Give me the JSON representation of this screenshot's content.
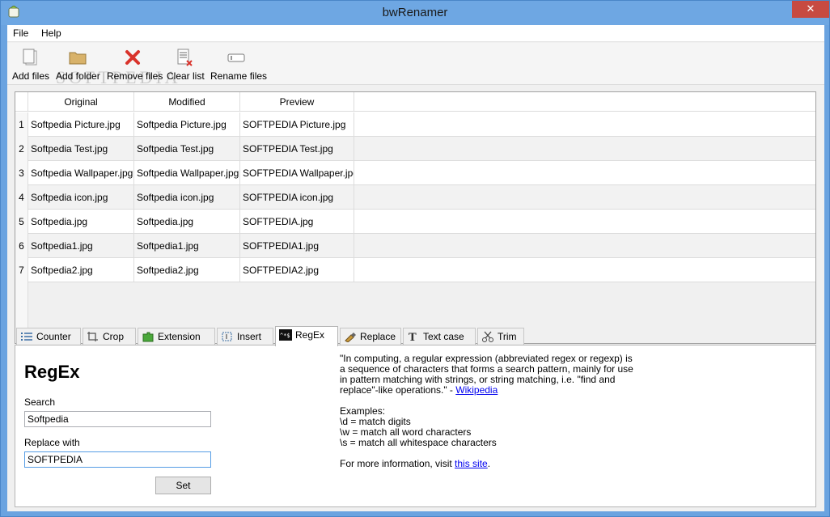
{
  "window": {
    "title": "bwRenamer",
    "close_glyph": "✕"
  },
  "menu": {
    "items": [
      "File",
      "Help"
    ]
  },
  "toolbar": {
    "buttons": [
      {
        "label": "Add files",
        "icon": "add-files-icon"
      },
      {
        "label": "Add folder",
        "icon": "add-folder-icon"
      },
      {
        "label": "Remove files",
        "icon": "remove-files-icon"
      },
      {
        "label": "Clear list",
        "icon": "clear-list-icon"
      },
      {
        "label": "Rename files",
        "icon": "rename-files-icon"
      }
    ],
    "watermark": "SOFTPEDIA"
  },
  "grid": {
    "columns": [
      "Original",
      "Modified",
      "Preview"
    ],
    "rows": [
      {
        "num": "1",
        "original": "Softpedia Picture.jpg",
        "modified": "Softpedia Picture.jpg",
        "preview": "SOFTPEDIA Picture.jpg"
      },
      {
        "num": "2",
        "original": "Softpedia Test.jpg",
        "modified": "Softpedia Test.jpg",
        "preview": "SOFTPEDIA Test.jpg"
      },
      {
        "num": "3",
        "original": "Softpedia Wallpaper.jpg",
        "modified": "Softpedia Wallpaper.jpg",
        "preview": "SOFTPEDIA Wallpaper.jpg"
      },
      {
        "num": "4",
        "original": "Softpedia icon.jpg",
        "modified": "Softpedia icon.jpg",
        "preview": "SOFTPEDIA icon.jpg"
      },
      {
        "num": "5",
        "original": "Softpedia.jpg",
        "modified": "Softpedia.jpg",
        "preview": "SOFTPEDIA.jpg"
      },
      {
        "num": "6",
        "original": "Softpedia1.jpg",
        "modified": "Softpedia1.jpg",
        "preview": "SOFTPEDIA1.jpg"
      },
      {
        "num": "7",
        "original": "Softpedia2.jpg",
        "modified": "Softpedia2.jpg",
        "preview": "SOFTPEDIA2.jpg"
      }
    ]
  },
  "tabs": [
    {
      "label": "Counter",
      "icon": "counter-icon"
    },
    {
      "label": "Crop",
      "icon": "crop-icon"
    },
    {
      "label": "Extension",
      "icon": "extension-icon"
    },
    {
      "label": "Insert",
      "icon": "insert-icon"
    },
    {
      "label": "RegEx",
      "icon": "regex-icon",
      "active": true
    },
    {
      "label": "Replace",
      "icon": "replace-icon"
    },
    {
      "label": "Text case",
      "icon": "text-case-icon"
    },
    {
      "label": "Trim",
      "icon": "trim-icon"
    }
  ],
  "regex_panel": {
    "title": "RegEx",
    "search_label": "Search",
    "search_value": "Softpedia",
    "replace_label": "Replace with",
    "replace_value": "SOFTPEDIA",
    "set_label": "Set",
    "description": "\"In computing, a regular expression (abbreviated regex or regexp) is a sequence of characters that forms a search pattern, mainly for use in pattern matching with strings, or string matching, i.e. \"find and replace\"-like operations.\" - ",
    "wikipedia_link": "Wikipedia",
    "examples_heading": "Examples:",
    "examples": [
      "\\d = match digits",
      "\\w = match all word characters",
      "\\s = match all whitespace characters"
    ],
    "more_info_prefix": "For more information, visit ",
    "more_info_link": "this site",
    "more_info_suffix": "."
  }
}
